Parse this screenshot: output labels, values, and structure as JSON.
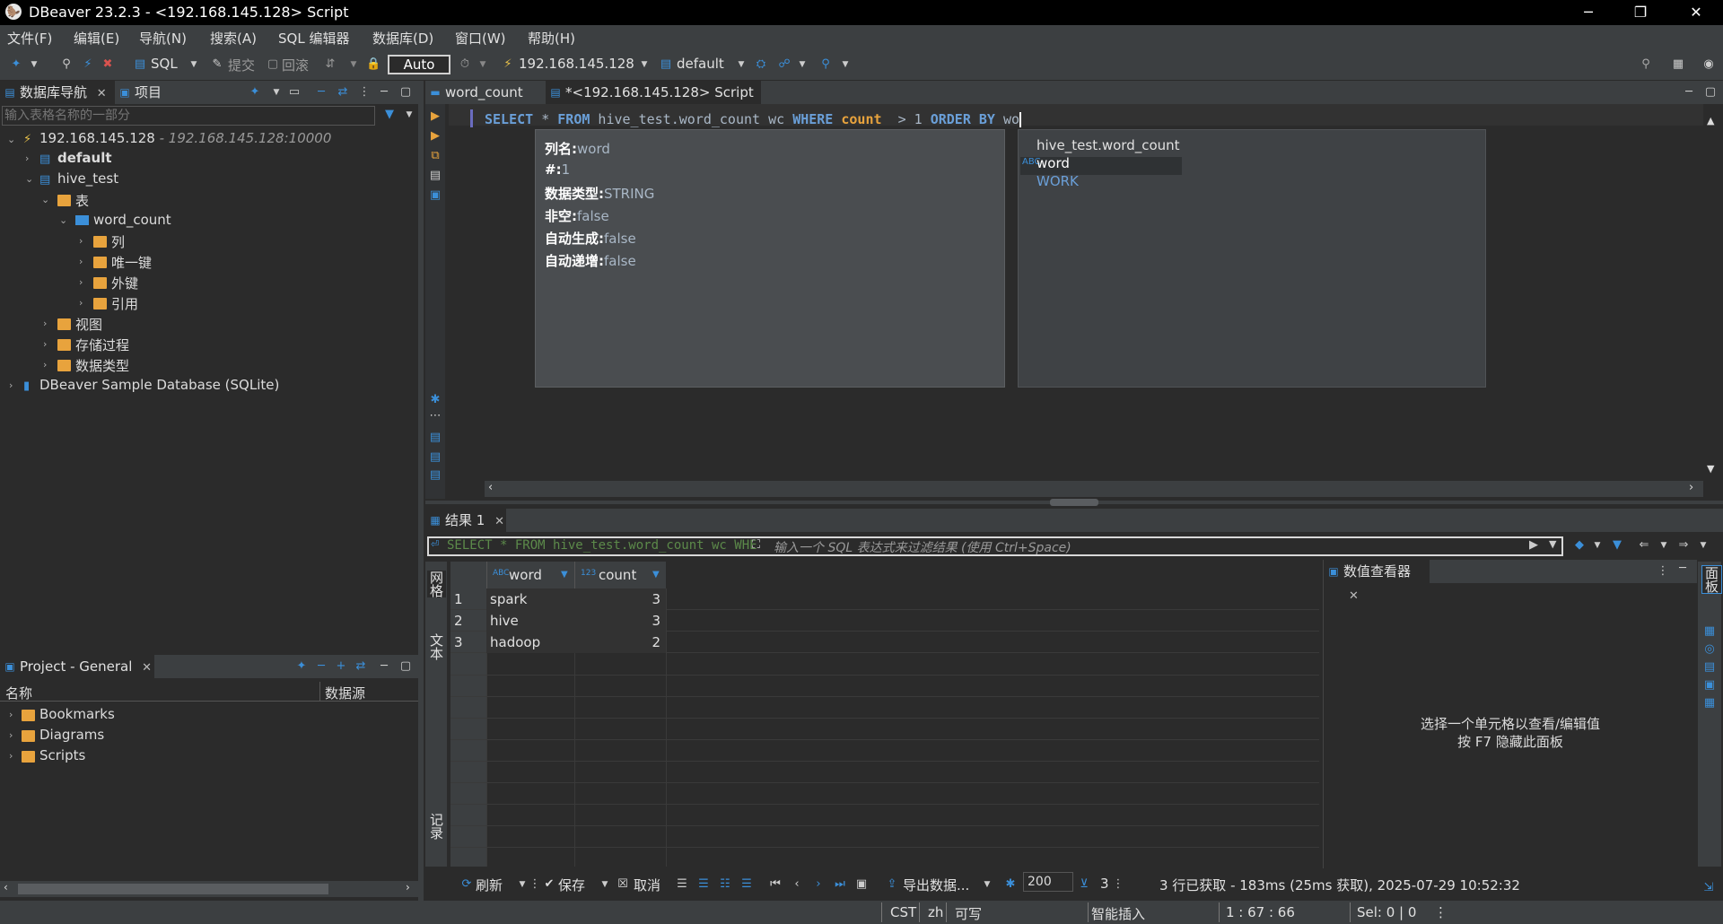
{
  "title": "DBeaver 23.2.3 - <192.168.145.128> Script",
  "window_controls": {
    "minimize": "─",
    "maximize": "❐",
    "close": "✕"
  },
  "menu": [
    "文件(F)",
    "编辑(E)",
    "导航(N)",
    "搜索(A)",
    "SQL 编辑器",
    "数据库(D)",
    "窗口(W)",
    "帮助(H)"
  ],
  "toolbar": {
    "sql": "SQL",
    "commit": "提交",
    "rollback": "回滚",
    "auto": "Auto",
    "connection": "192.168.145.128",
    "schema": "default"
  },
  "navigator": {
    "tab1": "数据库导航",
    "tab2": "项目",
    "filter_placeholder": "输入表格名称的一部分",
    "tree": [
      {
        "label": "192.168.145.128",
        "suffix": " - 192.168.145.128:10000"
      },
      {
        "label": "default"
      },
      {
        "label": "hive_test"
      },
      {
        "label": "表"
      },
      {
        "label": "word_count"
      },
      {
        "label": "列"
      },
      {
        "label": "唯一键"
      },
      {
        "label": "外键"
      },
      {
        "label": "引用"
      },
      {
        "label": "视图"
      },
      {
        "label": "存储过程"
      },
      {
        "label": "数据类型"
      },
      {
        "label": "DBeaver Sample Database (SQLite)"
      }
    ]
  },
  "project": {
    "tab": "Project - General",
    "col_name": "名称",
    "col_source": "数据源",
    "items": [
      "Bookmarks",
      "Diagrams",
      "Scripts"
    ]
  },
  "editor": {
    "tab1": "word_count",
    "tab2": "*<192.168.145.128> Script",
    "sql_kw_select": "SELECT",
    "sql_star": " * ",
    "sql_kw_from": "FROM",
    "sql_table": " hive_test.word_count wc ",
    "sql_kw_where": "WHERE",
    "sql_count": " count ",
    "sql_gt": " > 1 ",
    "sql_kw_order": "ORDER BY",
    "sql_tail": " wo",
    "info": [
      {
        "k": "列名:",
        "v": "word"
      },
      {
        "k": "#:",
        "v": "1"
      },
      {
        "k": "数据类型:",
        "v": "STRING"
      },
      {
        "k": "非空:",
        "v": "false"
      },
      {
        "k": "自动生成:",
        "v": "false"
      },
      {
        "k": "自动递增:",
        "v": "false"
      }
    ],
    "suggestions": [
      "hive_test.word_count",
      "word",
      "WORK"
    ]
  },
  "results": {
    "tab": "结果 1",
    "filter_sql": "SELECT * FROM hive_test.word_count wc WHE",
    "filter_placeholder": "输入一个 SQL 表达式来过滤结果 (使用 Ctrl+Space)",
    "side_grid": "网格",
    "side_text": "文本",
    "side_record": "记录",
    "columns": [
      {
        "type": "ABC",
        "name": "word"
      },
      {
        "type": "123",
        "name": "count"
      }
    ],
    "rows": [
      {
        "n": "1",
        "word": "spark",
        "count": "3"
      },
      {
        "n": "2",
        "word": "hive",
        "count": "3"
      },
      {
        "n": "3",
        "word": "hadoop",
        "count": "2"
      }
    ],
    "value_viewer": "数值查看器",
    "value_hint1": "选择一个单元格以查看/编辑值",
    "value_hint2": "按 F7 隐藏此面板",
    "panels_label": "面板",
    "bottom": {
      "refresh": "刷新",
      "save": "保存",
      "cancel": "取消",
      "export": "导出数据...",
      "fetch_size": "200",
      "row_count": "3",
      "summary": "3 行已获取 - 183ms (25ms 获取), 2025-07-29 10:52:32"
    }
  },
  "statusbar": {
    "tz": "CST",
    "lang": "zh",
    "mode": "可写",
    "insert": "智能插入",
    "pos": "1 : 67 : 66",
    "sel": "Sel: 0 | 0"
  }
}
